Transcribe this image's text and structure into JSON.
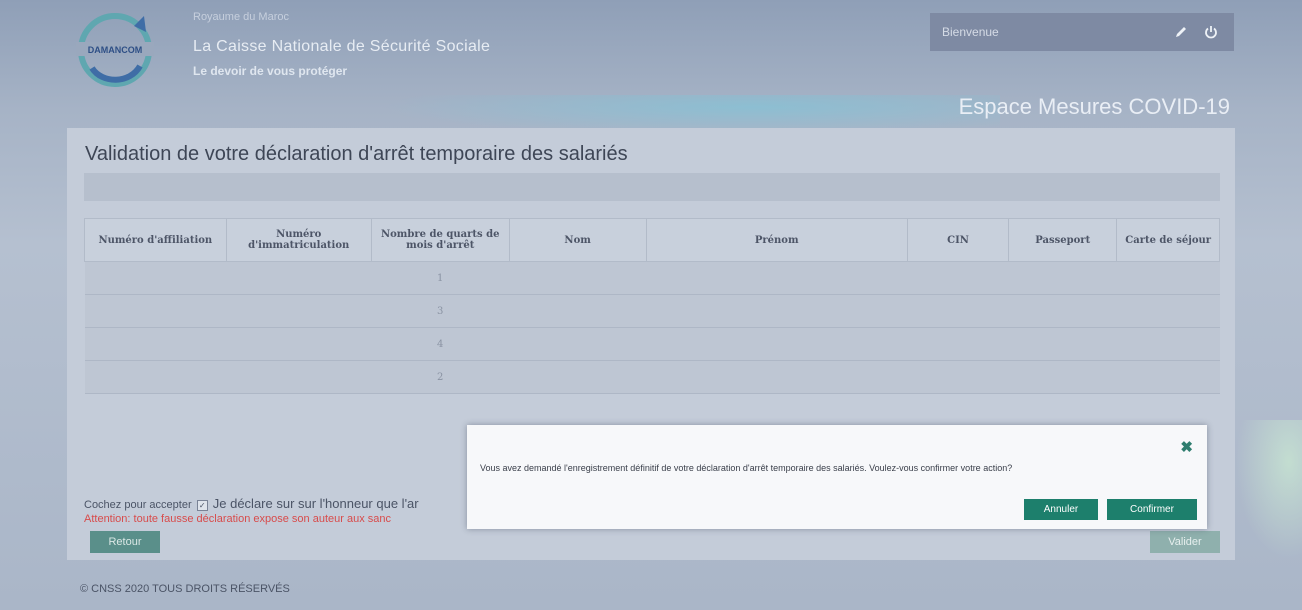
{
  "header": {
    "logo_text": "DAMANCOM",
    "kingdom": "Royaume du Maroc",
    "org_name": "La Caisse Nationale de Sécurité Sociale",
    "motto": "Le devoir de vous protéger",
    "welcome": "Bienvenue",
    "espace_title": "Espace Mesures COVID-19"
  },
  "main": {
    "page_title": "Validation de votre déclaration d'arrêt temporaire des salariés",
    "table": {
      "columns": [
        "Numéro d'affiliation",
        "Numéro d'immatriculation",
        "Nombre de quarts de mois d'arrêt",
        "Nom",
        "Prénom",
        "CIN",
        "Passeport",
        "Carte de séjour"
      ],
      "rows": [
        [
          "",
          "",
          "1",
          "",
          "",
          "",
          "",
          ""
        ],
        [
          "",
          "",
          "3",
          "",
          "",
          "",
          "",
          ""
        ],
        [
          "",
          "",
          "4",
          "",
          "",
          "",
          "",
          ""
        ],
        [
          "",
          "",
          "2",
          "",
          "",
          "",
          "",
          ""
        ]
      ]
    },
    "accept_label": "Cochez pour accepter",
    "declaration": "Je déclare sur sur l'honneur que l'ar",
    "warning": "Attention: toute fausse déclaration expose son auteur aux sanc",
    "retour": "Retour",
    "valider": "Valider"
  },
  "footer": {
    "text": "© CNSS 2020 TOUS DROITS RÉSERVÉS"
  },
  "modal": {
    "message": "Vous avez demandé l'enregistrement définitif de votre déclaration d'arrêt temporaire des salariés. Voulez-vous confirmer votre action?",
    "annuler": "Annuler",
    "confirmer": "Confirmer"
  },
  "colors": {
    "accent": "#1d7f6c",
    "warning": "#d84b4b"
  },
  "icons": [
    "pencil-icon",
    "power-icon",
    "close-icon",
    "checkbox-icon"
  ]
}
